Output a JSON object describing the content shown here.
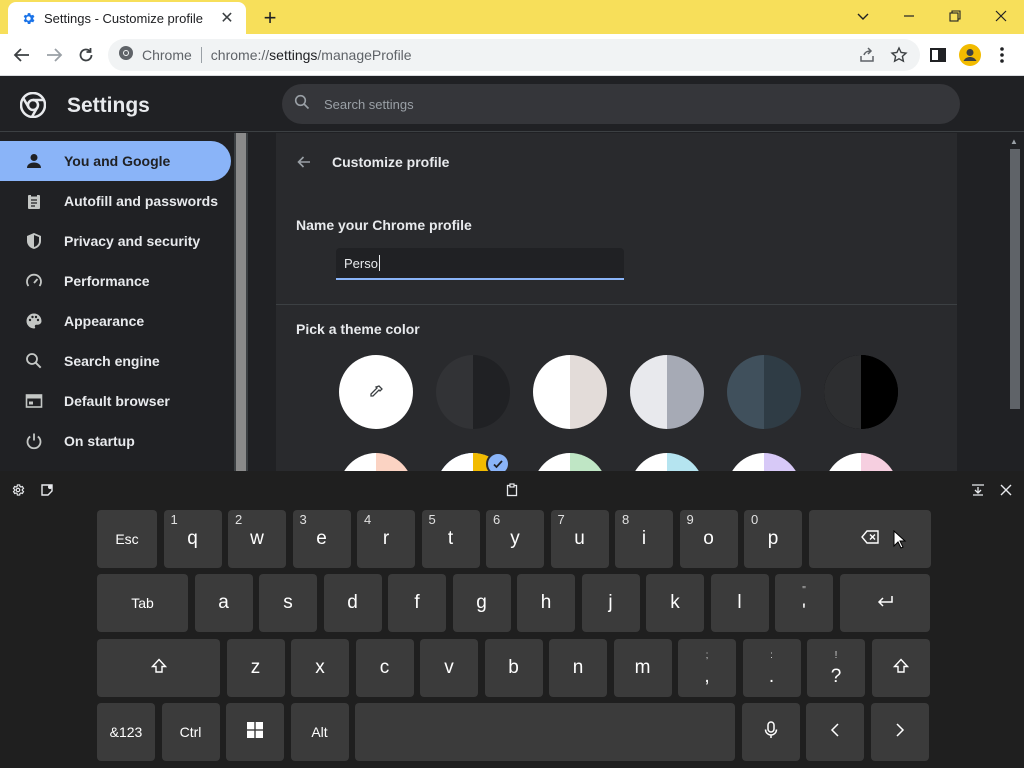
{
  "browser": {
    "tab_title": "Settings - Customize profile",
    "tab_close": "✕",
    "new_tab": "+",
    "site_label": "Chrome",
    "url_scheme": "chrome://",
    "url_host": "settings",
    "url_path": "/manageProfile"
  },
  "settings": {
    "title": "Settings",
    "search_placeholder": "Search settings",
    "nav": [
      {
        "label": "You and Google",
        "icon": "person-icon",
        "active": true
      },
      {
        "label": "Autofill and passwords",
        "icon": "clipboard-icon"
      },
      {
        "label": "Privacy and security",
        "icon": "shield-icon"
      },
      {
        "label": "Performance",
        "icon": "speedometer-icon"
      },
      {
        "label": "Appearance",
        "icon": "palette-icon"
      },
      {
        "label": "Search engine",
        "icon": "search-icon"
      },
      {
        "label": "Default browser",
        "icon": "browser-window-icon"
      },
      {
        "label": "On startup",
        "icon": "power-icon"
      }
    ],
    "page_title": "Customize profile",
    "name_section_title": "Name your Chrome profile",
    "name_value": "Perso",
    "theme_section_title": "Pick a theme color",
    "theme_colors": [
      {
        "left": "#ffffff",
        "right": "#ffffff",
        "kind": "custom-picker"
      },
      {
        "left": "#323336",
        "right": "#202124"
      },
      {
        "left": "#ffffff",
        "right": "#e3dcd9"
      },
      {
        "left": "#e8e9ed",
        "right": "#a6aab5"
      },
      {
        "left": "#40505c",
        "right": "#2f3c45"
      },
      {
        "left": "#2d2e30",
        "right": "#000000"
      },
      {
        "left": "#ffffff",
        "right": "#fbd3c3"
      },
      {
        "left": "#ffffff",
        "right": "#f2bb00",
        "selected": true
      },
      {
        "left": "#ffffff",
        "right": "#bfe6c5"
      },
      {
        "left": "#ffffff",
        "right": "#b5e4f0"
      },
      {
        "left": "#ffffff",
        "right": "#d7c9f7"
      },
      {
        "left": "#ffffff",
        "right": "#f6cfe0"
      }
    ]
  },
  "keyboard": {
    "rows": [
      [
        {
          "label": "Esc",
          "w": 60,
          "small": true
        },
        {
          "label": "q",
          "num": "1"
        },
        {
          "label": "w",
          "num": "2"
        },
        {
          "label": "e",
          "num": "3"
        },
        {
          "label": "r",
          "num": "4"
        },
        {
          "label": "t",
          "num": "5"
        },
        {
          "label": "y",
          "num": "6"
        },
        {
          "label": "u",
          "num": "7"
        },
        {
          "label": "i",
          "num": "8"
        },
        {
          "label": "o",
          "num": "9"
        },
        {
          "label": "p",
          "num": "0"
        },
        {
          "label": "",
          "icon": "backspace-icon",
          "w": 122
        }
      ],
      [
        {
          "label": "Tab",
          "w": 91,
          "small": true
        },
        {
          "label": "a"
        },
        {
          "label": "s"
        },
        {
          "label": "d"
        },
        {
          "label": "f"
        },
        {
          "label": "g"
        },
        {
          "label": "h"
        },
        {
          "label": "j"
        },
        {
          "label": "k"
        },
        {
          "label": "l"
        },
        {
          "label": "'",
          "alt": "\""
        },
        {
          "label": "",
          "icon": "enter-icon",
          "w": 90
        }
      ],
      [
        {
          "label": "",
          "icon": "shift-icon",
          "w": 123
        },
        {
          "label": "z"
        },
        {
          "label": "x"
        },
        {
          "label": "c"
        },
        {
          "label": "v"
        },
        {
          "label": "b"
        },
        {
          "label": "n"
        },
        {
          "label": "m"
        },
        {
          "label": ",",
          "alt": ";"
        },
        {
          "label": ".",
          "alt": ":"
        },
        {
          "label": "?",
          "alt": "!"
        },
        {
          "label": "",
          "icon": "shift-icon",
          "w": 58
        }
      ],
      [
        {
          "label": "&123",
          "w": 58,
          "small": true
        },
        {
          "label": "Ctrl",
          "small": true
        },
        {
          "label": "",
          "icon": "windows-icon"
        },
        {
          "label": "Alt",
          "small": true
        },
        {
          "label": "",
          "name": "spacebar",
          "w": 380
        },
        {
          "label": "",
          "icon": "microphone-icon"
        },
        {
          "label": "",
          "icon": "arrow-left-icon"
        },
        {
          "label": "",
          "icon": "arrow-right-icon"
        }
      ]
    ]
  },
  "colors": {
    "accent": "#8ab4f8",
    "tabstrip": "#f7df5a",
    "page_bg": "#202124",
    "card_bg": "#292a2d",
    "key_bg": "#3b3b3b"
  }
}
